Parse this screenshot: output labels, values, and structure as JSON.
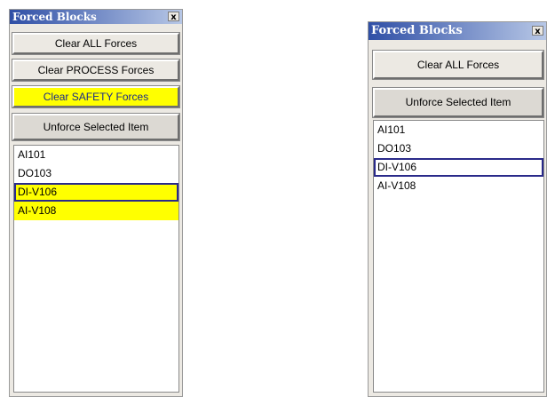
{
  "left_panel": {
    "title": "Forced Blocks",
    "close_glyph": "x",
    "buttons": {
      "clear_all": "Clear ALL Forces",
      "clear_process": "Clear PROCESS Forces",
      "clear_safety": "Clear SAFETY Forces",
      "unforce_selected": "Unforce Selected Item"
    },
    "items": [
      "AI101",
      "DO103",
      "DI-V106",
      "AI-V108"
    ],
    "highlight_color": "#ffff00",
    "focus_color": "#2a2a8a"
  },
  "right_panel": {
    "title": "Forced Blocks",
    "close_glyph": "x",
    "buttons": {
      "clear_all": "Clear ALL Forces",
      "unforce_selected": "Unforce Selected Item"
    },
    "items": [
      "AI101",
      "DO103",
      "DI-V106",
      "AI-V108"
    ]
  },
  "colors": {
    "title_bar_start": "#2f4fa6",
    "panel_background": "#ece9e3",
    "safety_button": "#ffff00"
  }
}
